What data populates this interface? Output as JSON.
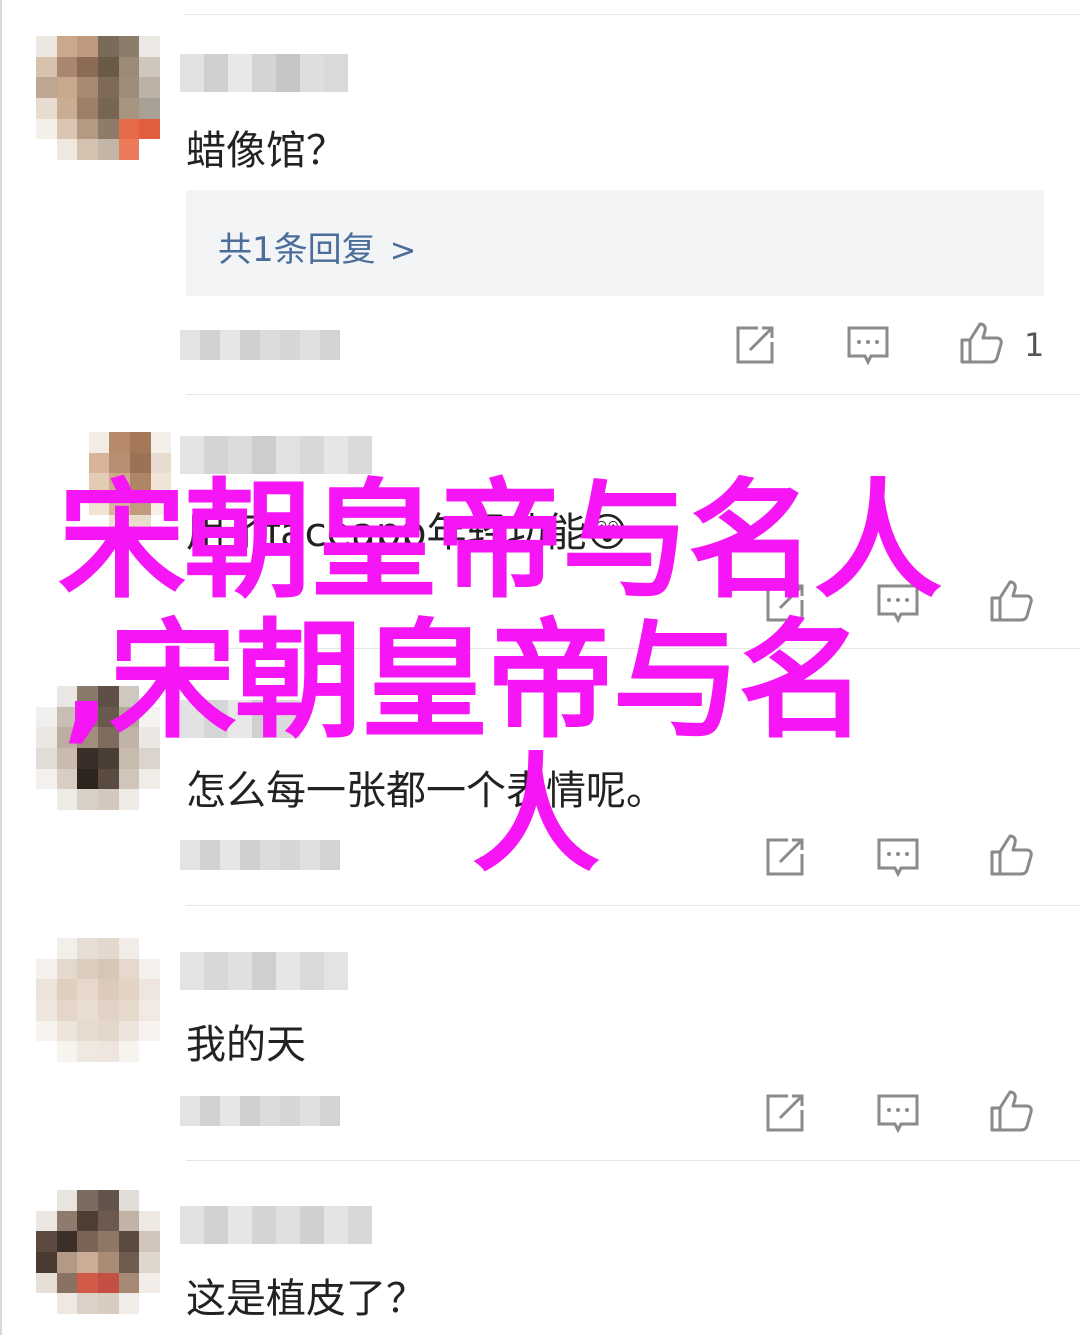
{
  "comments": [
    {
      "text": "蜡像馆？",
      "reply": {
        "label": "共1条回复",
        "chevron": ">"
      },
      "like_count": "1"
    },
    {
      "text": "用了faceapp年轻功能😲",
      "reply": null,
      "like_count": ""
    },
    {
      "text": "怎么每一张都一个表情呢。",
      "reply": null,
      "like_count": ""
    },
    {
      "text": "我的天",
      "reply": null,
      "like_count": ""
    },
    {
      "text": "这是植皮了？",
      "reply": null,
      "like_count": ""
    }
  ],
  "icons": {
    "share": "share-icon",
    "comment": "comment-icon",
    "like": "thumbs-up-icon"
  },
  "overlay": {
    "line1": "宋朝皇帝与名人",
    "line2": ",宋朝皇帝与名",
    "line3": "人",
    "color": "#f515f5"
  }
}
